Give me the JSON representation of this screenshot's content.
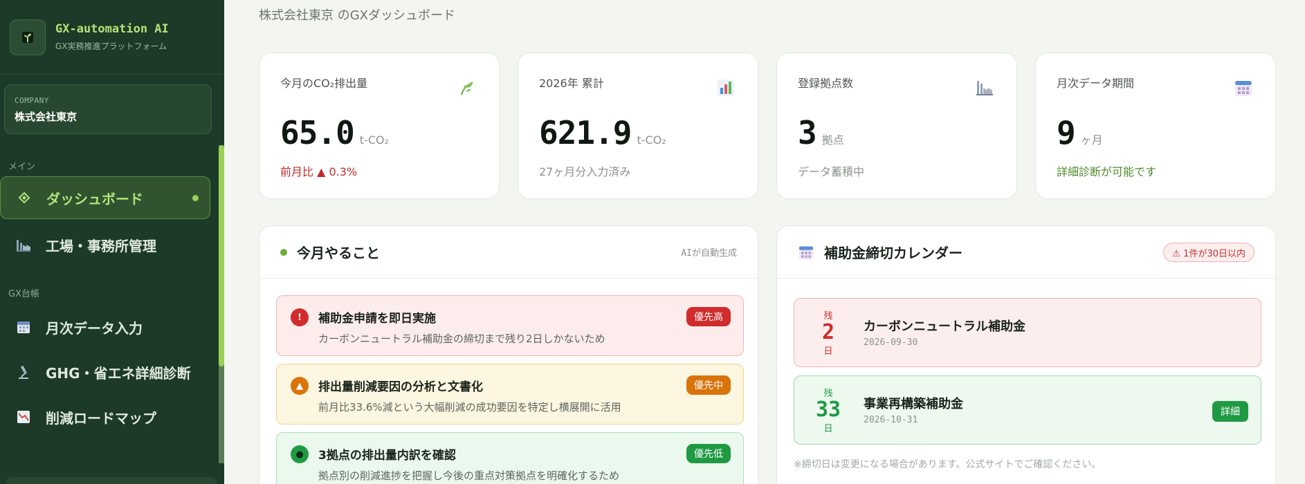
{
  "sidebar": {
    "brand_name": "GX-automation AI",
    "brand_sub": "GX実務推進プラットフォーム",
    "company_caption": "COMPANY",
    "company_name": "株式会社東京",
    "sections": [
      "メイン",
      "GX台帳"
    ],
    "items": [
      {
        "label": "ダッシュボード",
        "icon": "diamond-icon",
        "active": true
      },
      {
        "label": "工場・事務所管理",
        "icon": "factory-icon"
      },
      {
        "label": "月次データ入力",
        "icon": "calendar-icon"
      },
      {
        "label": "GHG・省エネ詳細診断",
        "icon": "microscope-icon"
      },
      {
        "label": "削減ロードマップ",
        "icon": "chart-down-icon"
      }
    ]
  },
  "header": {
    "subtitle": "株式会社東京 のGXダッシュボード"
  },
  "stats": [
    {
      "title": "今月のCO₂排出量",
      "value": "65.0",
      "unit": "t-CO₂",
      "note": "前月比 ▲ 0.3%",
      "icon": "leaf-icon"
    },
    {
      "title": "2026年 累計",
      "value": "621.9",
      "unit": "t-CO₂",
      "note": "27ヶ月分入力済み",
      "icon": "bar-chart-icon"
    },
    {
      "title": "登録拠点数",
      "value": "3",
      "unit": "拠点",
      "note": "データ蓄積中",
      "icon": "factory-icon"
    },
    {
      "title": "月次データ期間",
      "value": "9",
      "unit": "ヶ月",
      "note": "詳細診断が可能です",
      "icon": "calendar-icon"
    }
  ],
  "todo": {
    "title": "今月やること",
    "badge": "AIが自動生成",
    "tasks": [
      {
        "title": "補助金申請を即日実施",
        "desc": "カーボンニュートラル補助金の締切まで残り2日しかないため",
        "priority": "優先高",
        "icon_glyph": "!"
      },
      {
        "title": "排出量削減要因の分析と文書化",
        "desc": "前月比33.6%減という大幅削減の成功要因を特定し横展開に活用",
        "priority": "優先中",
        "icon_glyph": "▲"
      },
      {
        "title": "3拠点の排出量内訳を確認",
        "desc": "拠点別の削減進捗を把握し今後の重点対策拠点を明確化するため",
        "priority": "優先低",
        "icon_glyph": "●"
      }
    ]
  },
  "calendar": {
    "title": "補助金締切カレンダー",
    "warning": "⚠ 1件が30日以内",
    "items": [
      {
        "remain_label": "残",
        "days": "2",
        "day_unit": "日",
        "name": "カーボンニュートラル補助金",
        "date": "2026-09-30"
      },
      {
        "remain_label": "残",
        "days": "33",
        "day_unit": "日",
        "name": "事業再構築補助金",
        "date": "2026-10-31",
        "button": "詳細"
      }
    ],
    "footnote": "※締切日は変更になる場合があります。公式サイトでご確認ください。"
  },
  "colors": {
    "sidebar_bg": "#1c3a27",
    "accent": "#9bd15a",
    "danger": "#d12b2b",
    "warning": "#d9740b",
    "success": "#1f9a43"
  }
}
